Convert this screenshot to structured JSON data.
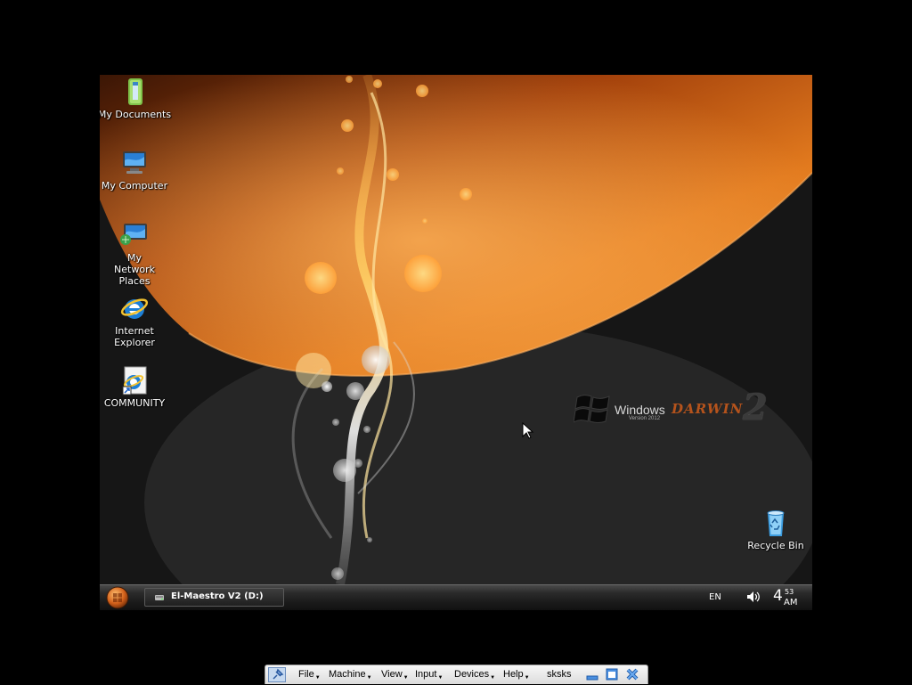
{
  "desktop": {
    "icons": [
      {
        "label": "My Documents",
        "icon": "folder-documents-icon"
      },
      {
        "label": "My Computer",
        "icon": "computer-icon"
      },
      {
        "label": "My Network Places",
        "icon": "network-places-icon"
      },
      {
        "label": "Internet Explorer",
        "icon": "internet-explorer-icon"
      },
      {
        "label": "COMMUNITY",
        "icon": "community-shortcut-icon"
      },
      {
        "label": "Recycle Bin",
        "icon": "recycle-bin-icon"
      }
    ],
    "brand": {
      "windows": "Windows",
      "version": "Version 2012",
      "name": "DARWIN",
      "number": "2"
    },
    "colors": {
      "accent_orange": "#e27a1e",
      "background_dark": "#1c1c1c"
    }
  },
  "taskbar": {
    "task": "El-Maestro V2 (D:)",
    "language": "EN",
    "clock": {
      "hour": "4",
      "minute": "53",
      "ampm": "AM"
    }
  },
  "vm_toolbar": {
    "menus": [
      "File",
      "Machine",
      "View",
      "Input",
      "Devices",
      "Help"
    ],
    "vm_name": "sksks"
  }
}
